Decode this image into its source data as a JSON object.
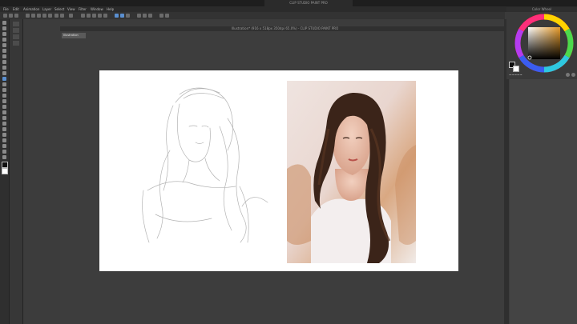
{
  "window": {
    "title": "CLIP STUDIO PAINT PRO"
  },
  "menu": [
    "File",
    "Edit",
    "Animation",
    "Layer",
    "Select",
    "View",
    "Filter",
    "Window",
    "Help"
  ],
  "document": {
    "title": "Illustration* (916 x 518px 350dpi 65.0%) - CLIP STUDIO PAINT PRO",
    "tab": "Illustration"
  },
  "color_wheel": {
    "title": "Color Wheel",
    "hex": "~~~~~",
    "main_color": "#0d0d0d",
    "sub_color": "#ffffff",
    "hue_color": "#e79b2a"
  },
  "colors": {
    "titlebar": "#1e1e1e",
    "toolbar": "#2f2f2f",
    "workspace": "#3c3c3c",
    "canvas": "#ffffff",
    "accent": "#5a8fd0"
  }
}
